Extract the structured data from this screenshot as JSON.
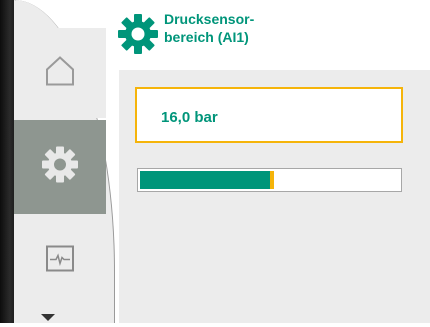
{
  "header": {
    "title_line1": "Drucksensor-",
    "title_line2": "bereich (AI1)",
    "icon": "gear-icon"
  },
  "nav": {
    "items": [
      {
        "name": "home",
        "icon": "home-icon",
        "active": false
      },
      {
        "name": "settings",
        "icon": "gear-icon",
        "active": true
      },
      {
        "name": "diagnostics",
        "icon": "graph-icon",
        "active": false
      }
    ],
    "scroll_icon": "triangle-down-icon"
  },
  "main": {
    "value": "16,0 bar",
    "level_fraction": 0.5
  },
  "colors": {
    "accent_green": "#00957a",
    "accent_yellow": "#f5b40a",
    "panel_bg": "#ececec",
    "nav_active": "#8e9690"
  }
}
